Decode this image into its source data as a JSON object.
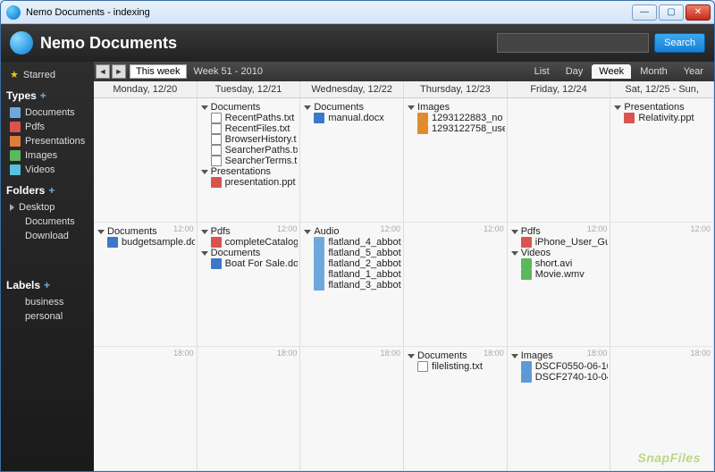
{
  "window": {
    "title": "Nemo Documents - indexing"
  },
  "header": {
    "app_name": "Nemo Documents",
    "search_placeholder": "",
    "search_btn": "Search"
  },
  "sidebar": {
    "starred": "Starred",
    "types": {
      "header": "Types",
      "items": [
        "Documents",
        "Pdfs",
        "Presentations",
        "Images",
        "Videos"
      ]
    },
    "folders": {
      "header": "Folders",
      "items": [
        "Desktop",
        "Documents",
        "Download"
      ]
    },
    "labels": {
      "header": "Labels",
      "items": [
        "business",
        "personal"
      ]
    }
  },
  "toolbar": {
    "this_week": "This week",
    "week_label": "Week 51 - 2010",
    "views": [
      "List",
      "Day",
      "Week",
      "Month",
      "Year"
    ],
    "active_view": "Week"
  },
  "days": [
    "Monday, 12/20",
    "Tuesday, 12/21",
    "Wednesday, 12/22",
    "Thursday, 12/23",
    "Friday, 12/24",
    "Sat, 12/25 - Sun,"
  ],
  "times": [
    "",
    "12:00",
    "18:00"
  ],
  "cells": {
    "mon": [
      [],
      [
        {
          "cat": "Documents",
          "files": [
            {
              "i": "docx",
              "n": "budgetsample.do"
            }
          ]
        }
      ],
      []
    ],
    "tue": [
      [
        {
          "cat": "Documents",
          "files": [
            {
              "i": "txt",
              "n": "RecentPaths.txt"
            },
            {
              "i": "txt",
              "n": "RecentFiles.txt"
            },
            {
              "i": "txt",
              "n": "BrowserHistory.t"
            },
            {
              "i": "txt",
              "n": "SearcherPaths.tx"
            },
            {
              "i": "txt",
              "n": "SearcherTerms.t"
            }
          ]
        },
        {
          "cat": "Presentations",
          "files": [
            {
              "i": "ppt",
              "n": "presentation.ppt"
            }
          ]
        }
      ],
      [
        {
          "cat": "Pdfs",
          "files": [
            {
              "i": "pdf",
              "n": "completeCatalog"
            }
          ]
        },
        {
          "cat": "Documents",
          "files": [
            {
              "i": "docx",
              "n": "Boat For Sale.do"
            }
          ]
        }
      ],
      []
    ],
    "wed": [
      [
        {
          "cat": "Documents",
          "files": [
            {
              "i": "docx",
              "n": "manual.docx"
            }
          ]
        }
      ],
      [
        {
          "cat": "Audio",
          "files": [
            {
              "i": "audio",
              "n": "flatland_4_abbot"
            },
            {
              "i": "audio",
              "n": "flatland_5_abbot"
            },
            {
              "i": "audio",
              "n": "flatland_2_abbot"
            },
            {
              "i": "audio",
              "n": "flatland_1_abbot"
            },
            {
              "i": "audio",
              "n": "flatland_3_abbot"
            }
          ]
        }
      ],
      []
    ],
    "thu": [
      [
        {
          "cat": "Images",
          "files": [
            {
              "i": "img",
              "n": "1293122883_no"
            },
            {
              "i": "img",
              "n": "1293122758_use"
            }
          ]
        }
      ],
      [],
      [
        {
          "cat": "Documents",
          "files": [
            {
              "i": "txt",
              "n": "filelisting.txt"
            }
          ]
        }
      ]
    ],
    "fri": [
      [],
      [
        {
          "cat": "Pdfs",
          "files": [
            {
              "i": "pdf",
              "n": "iPhone_User_Gu"
            }
          ]
        },
        {
          "cat": "Videos",
          "files": [
            {
              "i": "vid",
              "n": "short.avi"
            },
            {
              "i": "vid",
              "n": "Movie.wmv"
            }
          ]
        }
      ],
      [
        {
          "cat": "Images",
          "files": [
            {
              "i": "img2",
              "n": "DSCF0550-06-10"
            },
            {
              "i": "img2",
              "n": "DSCF2740-10-04"
            }
          ]
        }
      ]
    ],
    "sat": [
      [
        {
          "cat": "Presentations",
          "files": [
            {
              "i": "ppt",
              "n": "Relativity.ppt"
            }
          ]
        }
      ],
      [],
      []
    ]
  },
  "watermark": "SnapFiles"
}
